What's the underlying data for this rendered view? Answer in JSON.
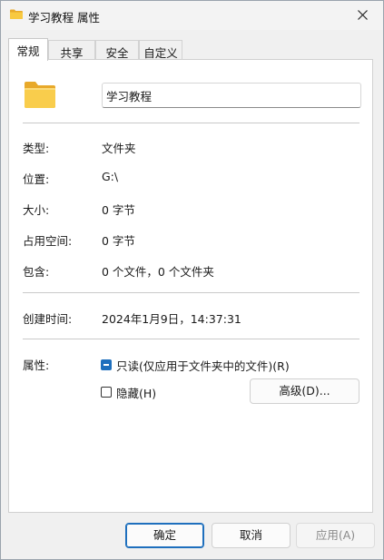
{
  "window": {
    "title": "学习教程 属性"
  },
  "tabs": [
    {
      "label": "常规",
      "active": true
    },
    {
      "label": "共享",
      "active": false
    },
    {
      "label": "安全",
      "active": false
    },
    {
      "label": "自定义",
      "active": false
    }
  ],
  "general": {
    "folder_name": "学习教程",
    "type_label": "类型:",
    "type_value": "文件夹",
    "location_label": "位置:",
    "location_value": "G:\\",
    "size_label": "大小:",
    "size_value": "0 字节",
    "size_on_disk_label": "占用空间:",
    "size_on_disk_value": "0 字节",
    "contains_label": "包含:",
    "contains_value": "0 个文件，0 个文件夹",
    "created_label": "创建时间:",
    "created_value": "2024年1月9日，14:37:31",
    "attributes_label": "属性:",
    "readonly_label": "只读(仅应用于文件夹中的文件)(R)",
    "readonly_state": "indeterminate",
    "hidden_label": "隐藏(H)",
    "hidden_state": "unchecked",
    "advanced_button": "高级(D)..."
  },
  "footer": {
    "ok": "确定",
    "cancel": "取消",
    "apply": "应用(A)"
  },
  "colors": {
    "accent": "#1e6fbd",
    "folder": "#f8c940"
  },
  "icons": {
    "title": "folder-icon",
    "big": "folder-icon",
    "close": "close-icon"
  }
}
